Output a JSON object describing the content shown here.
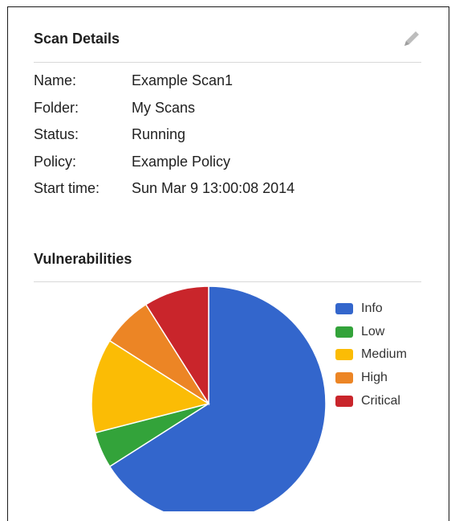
{
  "scan_details": {
    "title": "Scan Details",
    "fields": [
      {
        "label": "Name:",
        "value": "Example Scan1"
      },
      {
        "label": "Folder:",
        "value": "My Scans"
      },
      {
        "label": "Status:",
        "value": "Running"
      },
      {
        "label": "Policy:",
        "value": "Example Policy"
      },
      {
        "label": "Start time:",
        "value": "Sun Mar 9 13:00:08 2014"
      }
    ]
  },
  "vulnerabilities": {
    "title": "Vulnerabilities"
  },
  "chart_data": {
    "type": "pie",
    "categories": [
      "Info",
      "Low",
      "Medium",
      "High",
      "Critical"
    ],
    "values": [
      66,
      5,
      13,
      7,
      9
    ],
    "colors": [
      "#3366cc",
      "#33a33a",
      "#fbbc05",
      "#ec8525",
      "#c9252b"
    ],
    "legend_position": "right"
  }
}
